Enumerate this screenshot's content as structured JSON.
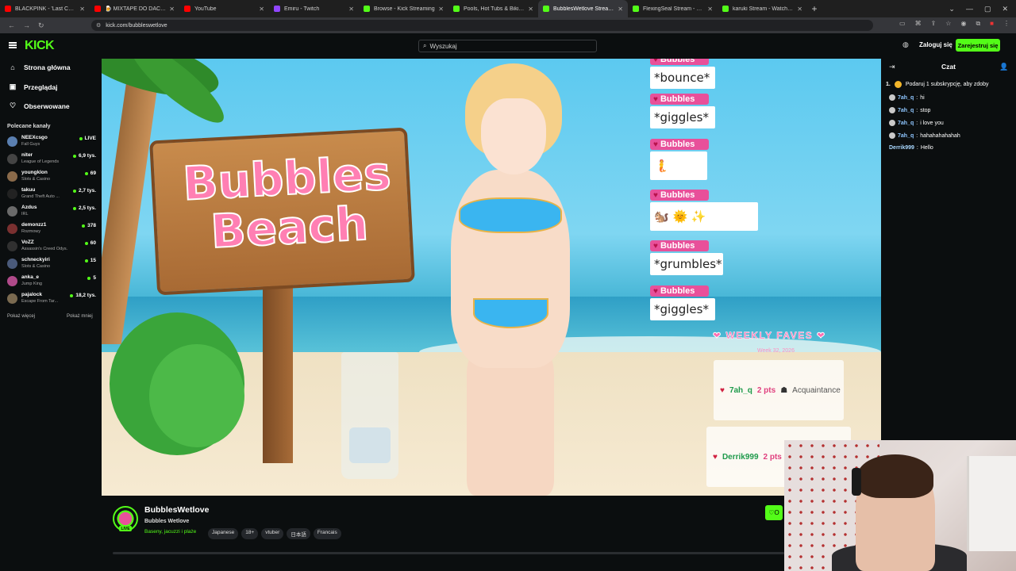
{
  "browser": {
    "tabs": [
      {
        "label": "BLACKPINK - 'Last Christmas' Li",
        "color": "#ff0000"
      },
      {
        "label": "🍺 MIXTAPE DO DACHOWAN",
        "color": "#ff0000"
      },
      {
        "label": "YouTube",
        "color": "#ff0000"
      },
      {
        "label": "Emiru - Twitch",
        "color": "#9146ff"
      },
      {
        "label": "Browse - Kick Streaming",
        "color": "#53fc18"
      },
      {
        "label": "Pools, Hot Tubs & Bikinis Strea",
        "color": "#53fc18"
      },
      {
        "label": "BubblesWetlove Stream - Watc",
        "color": "#53fc18",
        "active": true
      },
      {
        "label": "FlexingSeal Stream - Watch",
        "color": "#53fc18"
      },
      {
        "label": "karuki Stream - Watch Live on K",
        "color": "#53fc18"
      }
    ],
    "url": "kick.com/bubbleswetlove"
  },
  "header": {
    "logo": "KICK",
    "search_placeholder": "Wyszukaj",
    "login": "Zaloguj się",
    "register": "Zarejestruj się"
  },
  "sidebar": {
    "nav": [
      {
        "label": "Strona główna",
        "icon": "home-icon"
      },
      {
        "label": "Przeglądaj",
        "icon": "browse-icon"
      },
      {
        "label": "Obserwowane",
        "icon": "heart-icon"
      }
    ],
    "section_title": "Polecane kanały",
    "channels": [
      {
        "name": "NEEXcsgo",
        "game": "Fall Guys",
        "viewers": "LIVE",
        "color": "#5a7fb0"
      },
      {
        "name": "niter",
        "game": "League of Legends",
        "viewers": "6,9 tys.",
        "color": "#444"
      },
      {
        "name": "youngklon",
        "game": "Slots & Casino",
        "viewers": "69",
        "color": "#8a6a4a"
      },
      {
        "name": "takuu",
        "game": "Grand Theft Auto ...",
        "viewers": "2,7 tys.",
        "color": "#222"
      },
      {
        "name": "Azdus",
        "game": "IRL",
        "viewers": "2,5 tys.",
        "color": "#6a6a6a"
      },
      {
        "name": "demonzz1",
        "game": "Rozmowy",
        "viewers": "378",
        "color": "#7a3030"
      },
      {
        "name": "VoZZ",
        "game": "Assassin's Creed Odys...",
        "viewers": "60",
        "color": "#303030"
      },
      {
        "name": "schneckyiri",
        "game": "Slots & Casino",
        "viewers": "15",
        "color": "#4a5a7a"
      },
      {
        "name": "anka_e",
        "game": "Jump King",
        "viewers": "5",
        "color": "#b04a8a"
      },
      {
        "name": "pajalock",
        "game": "Escape From Tar...",
        "viewers": "18,2 tys.",
        "color": "#7a6a50"
      }
    ],
    "show_more": "Pokaż więcej",
    "show_less": "Pokaż mniej"
  },
  "video": {
    "sign_text": "Bubbles Beach",
    "alerts": [
      {
        "name": "Bubbles",
        "text": "*bounce*"
      },
      {
        "name": "Bubbles",
        "text": "*giggles*"
      },
      {
        "name": "Bubbles",
        "text": "🧜"
      },
      {
        "name": "Bubbles",
        "text": "🐿️ 🌞 ✨"
      },
      {
        "name": "Bubbles",
        "text": "*grumbles*"
      },
      {
        "name": "Bubbles",
        "text": "*giggles*"
      }
    ],
    "faves_title": "WEEKLY FAVES",
    "faves_sub": "Week 32, 2026",
    "faves": [
      {
        "name": "7ah_q",
        "pts": "2 pts",
        "rank": "Acquaintance"
      },
      {
        "name": "Derrik999",
        "pts": "2 pts",
        "rank": ""
      }
    ]
  },
  "stream": {
    "name": "BubblesWetlove",
    "title": "Bubbles Wetlove",
    "category": "Baseny, jacuzzi i plaże",
    "tags": [
      "Japanese",
      "18+",
      "vtuber",
      "日本語",
      "Francais"
    ],
    "live": "LIVE",
    "follow": "O"
  },
  "chat": {
    "title": "Czat",
    "pinned_rank": "1.",
    "pinned_text": "Podaruj 1 subskrypcję, aby zdoby",
    "messages": [
      {
        "user": "7ah_q",
        "text": "hi"
      },
      {
        "user": "7ah_q",
        "text": "stop"
      },
      {
        "user": "7ah_q",
        "text": "i love you"
      },
      {
        "user": "7ah_q",
        "text": "hahahahahahah"
      },
      {
        "user": "Derrik999",
        "text": "Hello"
      }
    ]
  }
}
